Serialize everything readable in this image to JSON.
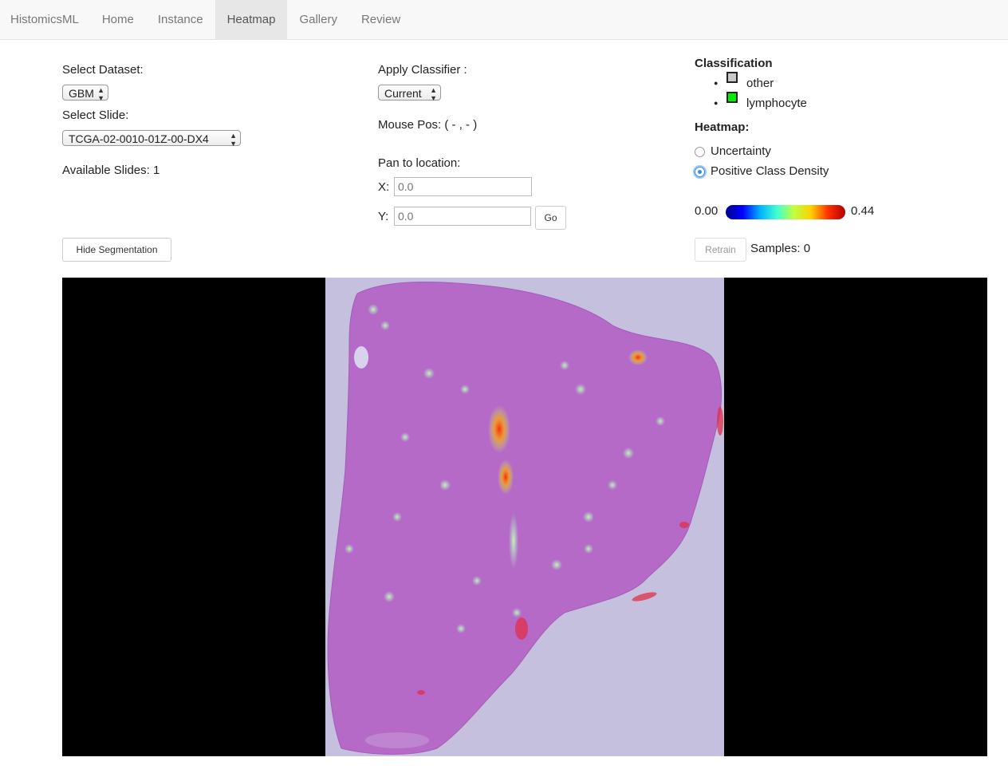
{
  "nav": {
    "brand": "HistomicsML",
    "links": [
      "Home",
      "Instance",
      "Heatmap",
      "Gallery",
      "Review"
    ],
    "active": "Heatmap"
  },
  "dataset": {
    "label": "Select Dataset:",
    "selected": "GBM"
  },
  "slide": {
    "label": "Select Slide:",
    "selected": "TCGA-02-0010-01Z-00-DX4"
  },
  "available_slides": "Available Slides: 1",
  "classifier": {
    "label": "Apply Classifier :",
    "selected": "Current"
  },
  "mouse_pos": "Mouse Pos: ( - , - )",
  "pan": {
    "label": "Pan to location:",
    "x_label": "X:",
    "x_placeholder": "0.0",
    "y_label": "Y:",
    "y_placeholder": "0.0",
    "go_label": "Go"
  },
  "hide_segmentation_label": "Hide Segmentation",
  "classification": {
    "title": "Classification",
    "classes": [
      {
        "name": "other",
        "color": "#c8c8c8"
      },
      {
        "name": "lymphocyte",
        "color": "#00ee00"
      }
    ]
  },
  "heatmap": {
    "title": "Heatmap:",
    "options": [
      "Uncertainty",
      "Positive Class Density"
    ],
    "selected": "Positive Class Density",
    "min_label": "0.00",
    "max_label": "0.44"
  },
  "retrain_label": "Retrain",
  "samples_text": "Samples: 0",
  "colors": {
    "tissue": "#b76ac8",
    "background_slide": "#c5c0de",
    "accent": "#3b8ee8"
  }
}
